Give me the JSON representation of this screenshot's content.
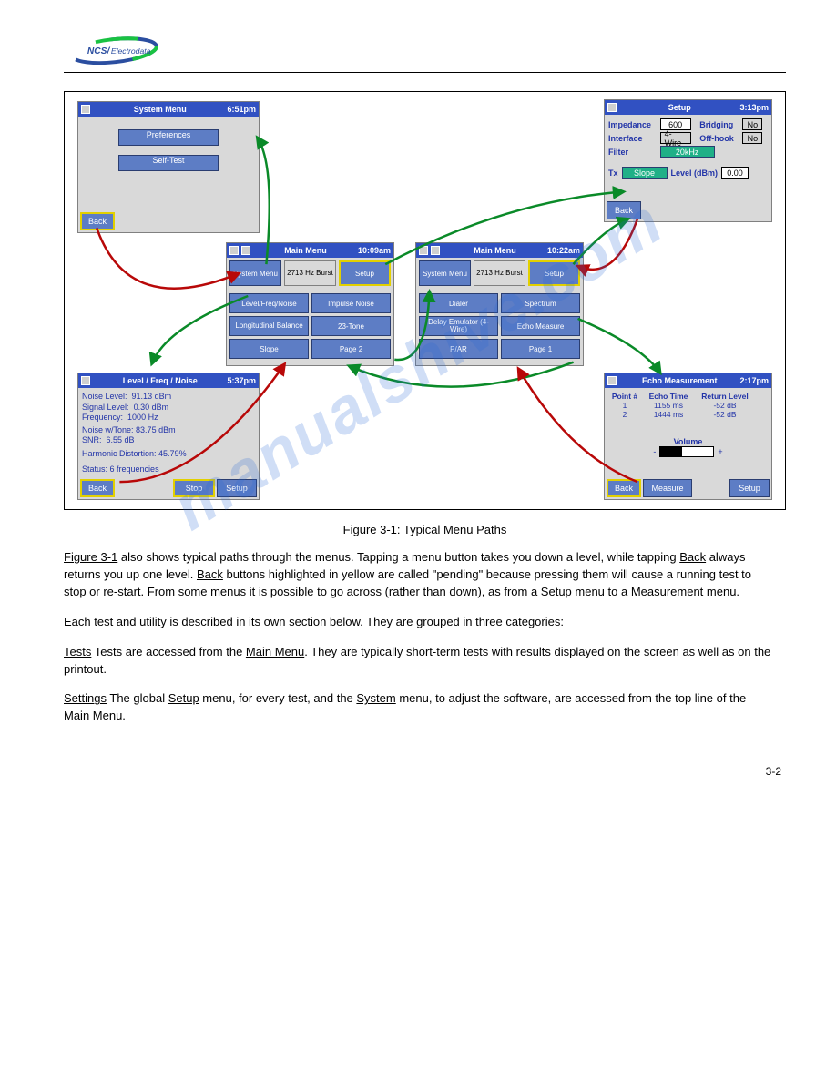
{
  "logo_text": "NCS/Electrodata",
  "watermark": "manualshive.com",
  "caption": "Figure 3-1: Typical Menu Paths",
  "body": {
    "p1_before": " also shows typical paths through the menus. Tapping a menu button takes you down a level, while tapping ",
    "p1_mid": " always returns you up one level. ",
    "p1_after": " buttons highlighted in yellow are called \"pending\" because pressing them will cause a running test to stop or re-start. From some menus it is possible to go across (rather than down), as from a Setup menu to a Measurement menu.",
    "p2": "Each test and utility is described in its own section below. They are grouped in three categories:",
    "p3_lead": "Tests are accessed from the ",
    "p3_after": ". They are typically short-term tests with results displayed on the screen as well as on the printout.",
    "p4_lead": "The global ",
    "p4_mid": " menu, for every test, and the ",
    "p4_after": " menu, to adjust the software, are accessed from the top line of the Main Menu.",
    "links": {
      "fig": "Figure 3-1",
      "back": "Back",
      "main_menu": "Main Menu",
      "tests": "Tests",
      "settings": "Settings",
      "setup": "Setup",
      "system": "System"
    }
  },
  "screens": {
    "system": {
      "title": "System Menu",
      "time": "6:51pm",
      "prefs": "Preferences",
      "selftest": "Self-Test",
      "back": "Back"
    },
    "setup": {
      "title": "Setup",
      "time": "3:13pm",
      "rows": {
        "impedance": {
          "lbl": "Impedance",
          "val": "600"
        },
        "interface": {
          "lbl": "Interface",
          "val": "4-Wire"
        },
        "filter": {
          "lbl": "Filter",
          "val": "20kHz"
        },
        "bridging": {
          "lbl": "Bridging",
          "val": "No"
        },
        "offhook": {
          "lbl": "Off-hook",
          "val": "No"
        },
        "tx": {
          "lbl": "Tx",
          "slope": "Slope",
          "level_lbl": "Level (dBm)",
          "level_val": "0.00"
        }
      },
      "back": "Back"
    },
    "mm1": {
      "title": "Main Menu",
      "time": "10:09am",
      "buttons": [
        "System Menu",
        "2713 Hz Burst",
        "Setup",
        "Level/Freq/Noise",
        "Impulse Noise",
        "Longitudinal Balance",
        "23-Tone",
        "Slope",
        "Page 2"
      ]
    },
    "mm2": {
      "title": "Main Menu",
      "time": "10:22am",
      "buttons": [
        "System Menu",
        "2713 Hz Burst",
        "Setup",
        "Dialer",
        "Spectrum",
        "Delay Emulator (4-Wire)",
        "Echo Measure",
        "P/AR",
        "Page 1"
      ]
    },
    "lfn": {
      "title": "Level / Freq / Noise",
      "time": "5:37pm",
      "lines": {
        "nl_lbl": "Noise Level:",
        "nl": "91.13 dBm",
        "sl_lbl": "Signal Level:",
        "sl": "0.30 dBm",
        "fr_lbl": "Frequency:",
        "fr": "1000 Hz",
        "nwt_lbl": "Noise w/Tone:",
        "nwt": "83.75 dBm",
        "snr_lbl": "SNR:",
        "snr": "6.55 dB",
        "hd_lbl": "Harmonic Distortion:",
        "hd": "45.79%",
        "status_lbl": "Status:",
        "status": "6 frequencies"
      },
      "back": "Back",
      "stop": "Stop",
      "setup": "Setup"
    },
    "echo": {
      "title": "Echo Measurement",
      "time": "2:17pm",
      "hdr": {
        "pt": "Point #",
        "et": "Echo Time",
        "rl": "Return Level"
      },
      "rows": [
        {
          "pt": "1",
          "et": "1155 ms",
          "rl": "-52 dB"
        },
        {
          "pt": "2",
          "et": "1444 ms",
          "rl": "-52 dB"
        }
      ],
      "volume": "Volume",
      "back": "Back",
      "measure": "Measure",
      "setup": "Setup"
    }
  },
  "footer": "3-2"
}
